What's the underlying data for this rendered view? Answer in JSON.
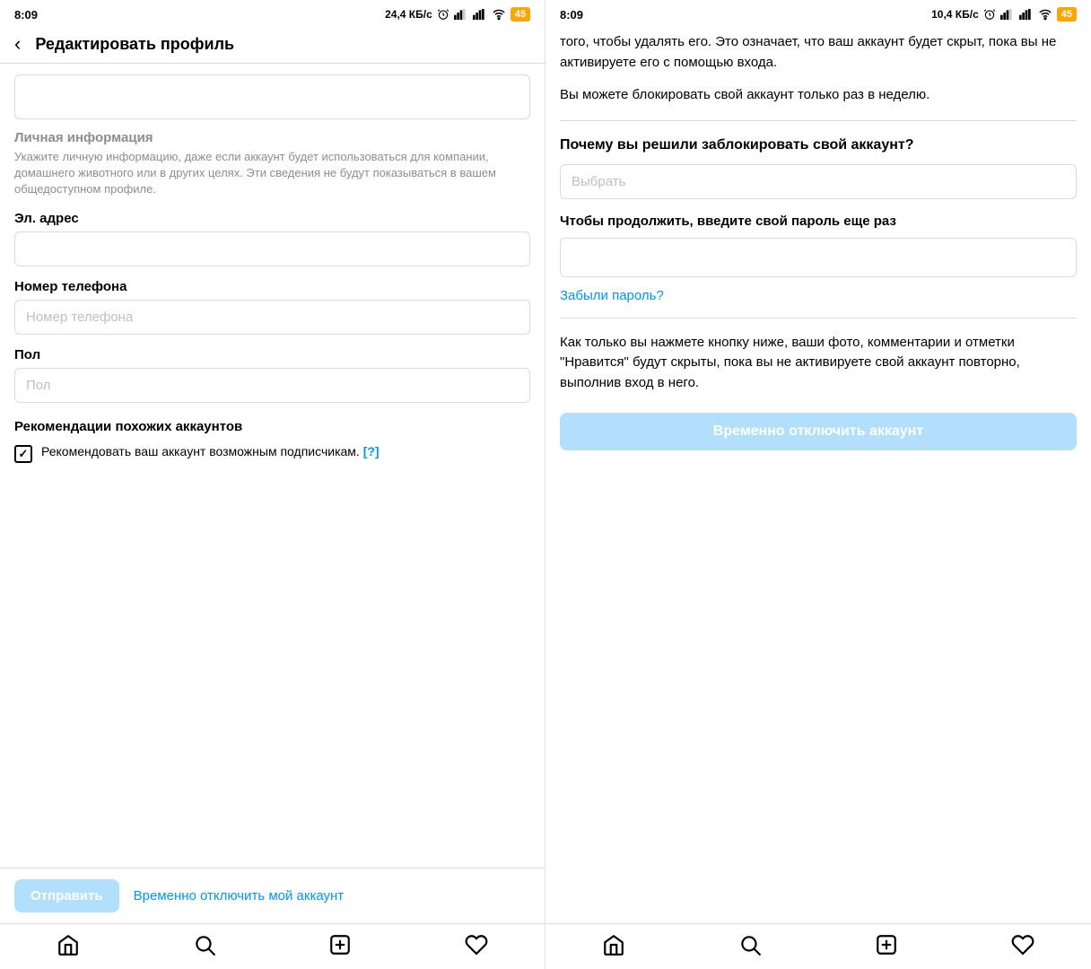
{
  "left": {
    "status": {
      "time": "8:09",
      "network": "24,4 КБ/с",
      "battery": "45"
    },
    "header": {
      "back_label": "‹",
      "title": "Редактировать профиль"
    },
    "personal_info": {
      "section_label": "Личная информация",
      "section_desc": "Укажите личную информацию, даже если аккаунт будет использоваться для компании, домашнего животного или в других целях. Эти сведения не будут показываться в вашем общедоступном профиле."
    },
    "email": {
      "label": "Эл. адрес",
      "placeholder": ""
    },
    "phone": {
      "label": "Номер телефона",
      "placeholder": "Номер телефона"
    },
    "gender": {
      "label": "Пол",
      "placeholder": "Пол"
    },
    "recommendations": {
      "title": "Рекомендации похожих аккаунтов",
      "checkbox_text": "Рекомендовать ваш аккаунт возможным подписчикам.",
      "help_text": "[?]",
      "checked": true
    },
    "actions": {
      "submit_label": "Отправить",
      "disable_label": "Временно отключить мой аккаунт"
    },
    "nav": {
      "home": "home",
      "search": "search",
      "add": "add",
      "heart": "heart"
    }
  },
  "right": {
    "status": {
      "time": "8:09",
      "network": "10,4 КБ/с",
      "battery": "45"
    },
    "body_text_1": "того, чтобы удалять его. Это означает, что ваш аккаунт будет скрыт, пока вы не активируете его с помощью входа.",
    "body_text_2": "Вы можете блокировать свой аккаунт только раз в неделю.",
    "question": {
      "title": "Почему вы решили заблокировать свой аккаунт?",
      "select_placeholder": "Выбрать"
    },
    "password": {
      "label": "Чтобы продолжить, введите свой пароль еще раз",
      "placeholder": ""
    },
    "forgot_password": "Забыли пароль?",
    "body_text_3": "Как только вы нажмете кнопку ниже, ваши фото, комментарии и отметки \"Нравится\" будут скрыты, пока вы не активируете свой аккаунт повторно, выполнив вход в него.",
    "disable_btn_label": "Временно отключить аккаунт",
    "nav": {
      "home": "home",
      "search": "search",
      "add": "add",
      "heart": "heart"
    }
  }
}
